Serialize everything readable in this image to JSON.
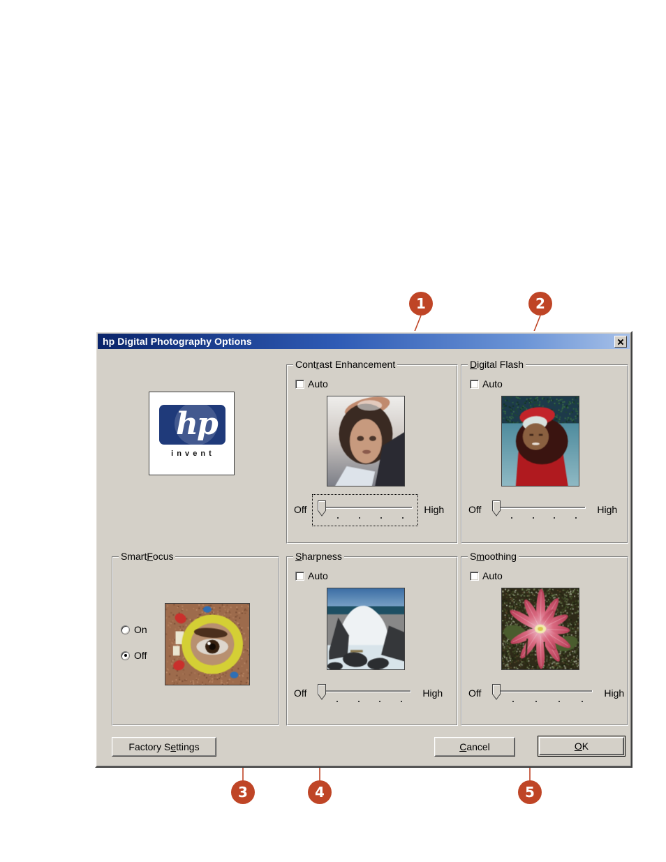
{
  "window": {
    "title": "hp Digital Photography Options",
    "close_icon": "close-icon",
    "titlebar_color": "#0a246a",
    "face_color": "#d4d0c8"
  },
  "logo": {
    "brand": "hp",
    "tagline": "i n v e n t",
    "brand_color": "#1f3a7a"
  },
  "groups": [
    {
      "id": "contrast-enhancement",
      "title": "Contrast Enhancement",
      "accel_index": 4,
      "auto_label": "Auto",
      "auto_checked": false,
      "slider": {
        "min_label": "Off",
        "max_label": "High",
        "value": 0,
        "ticks": 4,
        "focused": true
      },
      "preview": "child-portrait"
    },
    {
      "id": "digital-flash",
      "title": "Digital Flash",
      "accel_index": 0,
      "auto_label": "Auto",
      "auto_checked": false,
      "slider": {
        "min_label": "Off",
        "max_label": "High",
        "value": 0,
        "ticks": 4,
        "focused": false
      },
      "preview": "child-red-hood"
    },
    {
      "id": "smartfocus",
      "title": "SmartFocus",
      "accel_index": 5,
      "radios": [
        {
          "label": "On",
          "selected": false
        },
        {
          "label": "Off",
          "selected": true
        }
      ],
      "preview": "eye-magnifier"
    },
    {
      "id": "sharpness",
      "title": "Sharpness",
      "accel_index": 0,
      "auto_label": "Auto",
      "auto_checked": false,
      "slider": {
        "min_label": "Off",
        "max_label": "High",
        "value": 0,
        "ticks": 4,
        "focused": false
      },
      "preview": "ocean-wave"
    },
    {
      "id": "smoothing",
      "title": "Smoothing",
      "accel_index": 1,
      "auto_label": "Auto",
      "auto_checked": false,
      "slider": {
        "min_label": "Off",
        "max_label": "High",
        "value": 0,
        "ticks": 4,
        "focused": false
      },
      "preview": "pink-lotus"
    }
  ],
  "buttons": {
    "factory_settings": "Factory Settings",
    "factory_settings_accel": 9,
    "cancel": "Cancel",
    "cancel_accel": 0,
    "ok": "OK",
    "ok_accel": 0
  },
  "callouts": [
    {
      "number": "1",
      "target": "contrast-enhancement-title"
    },
    {
      "number": "2",
      "target": "digital-flash-title"
    },
    {
      "number": "3",
      "target": "smartfocus-group"
    },
    {
      "number": "4",
      "target": "sharpness-slider"
    },
    {
      "number": "5",
      "target": "smoothing-slider"
    }
  ],
  "callout_color": "#bf4526"
}
